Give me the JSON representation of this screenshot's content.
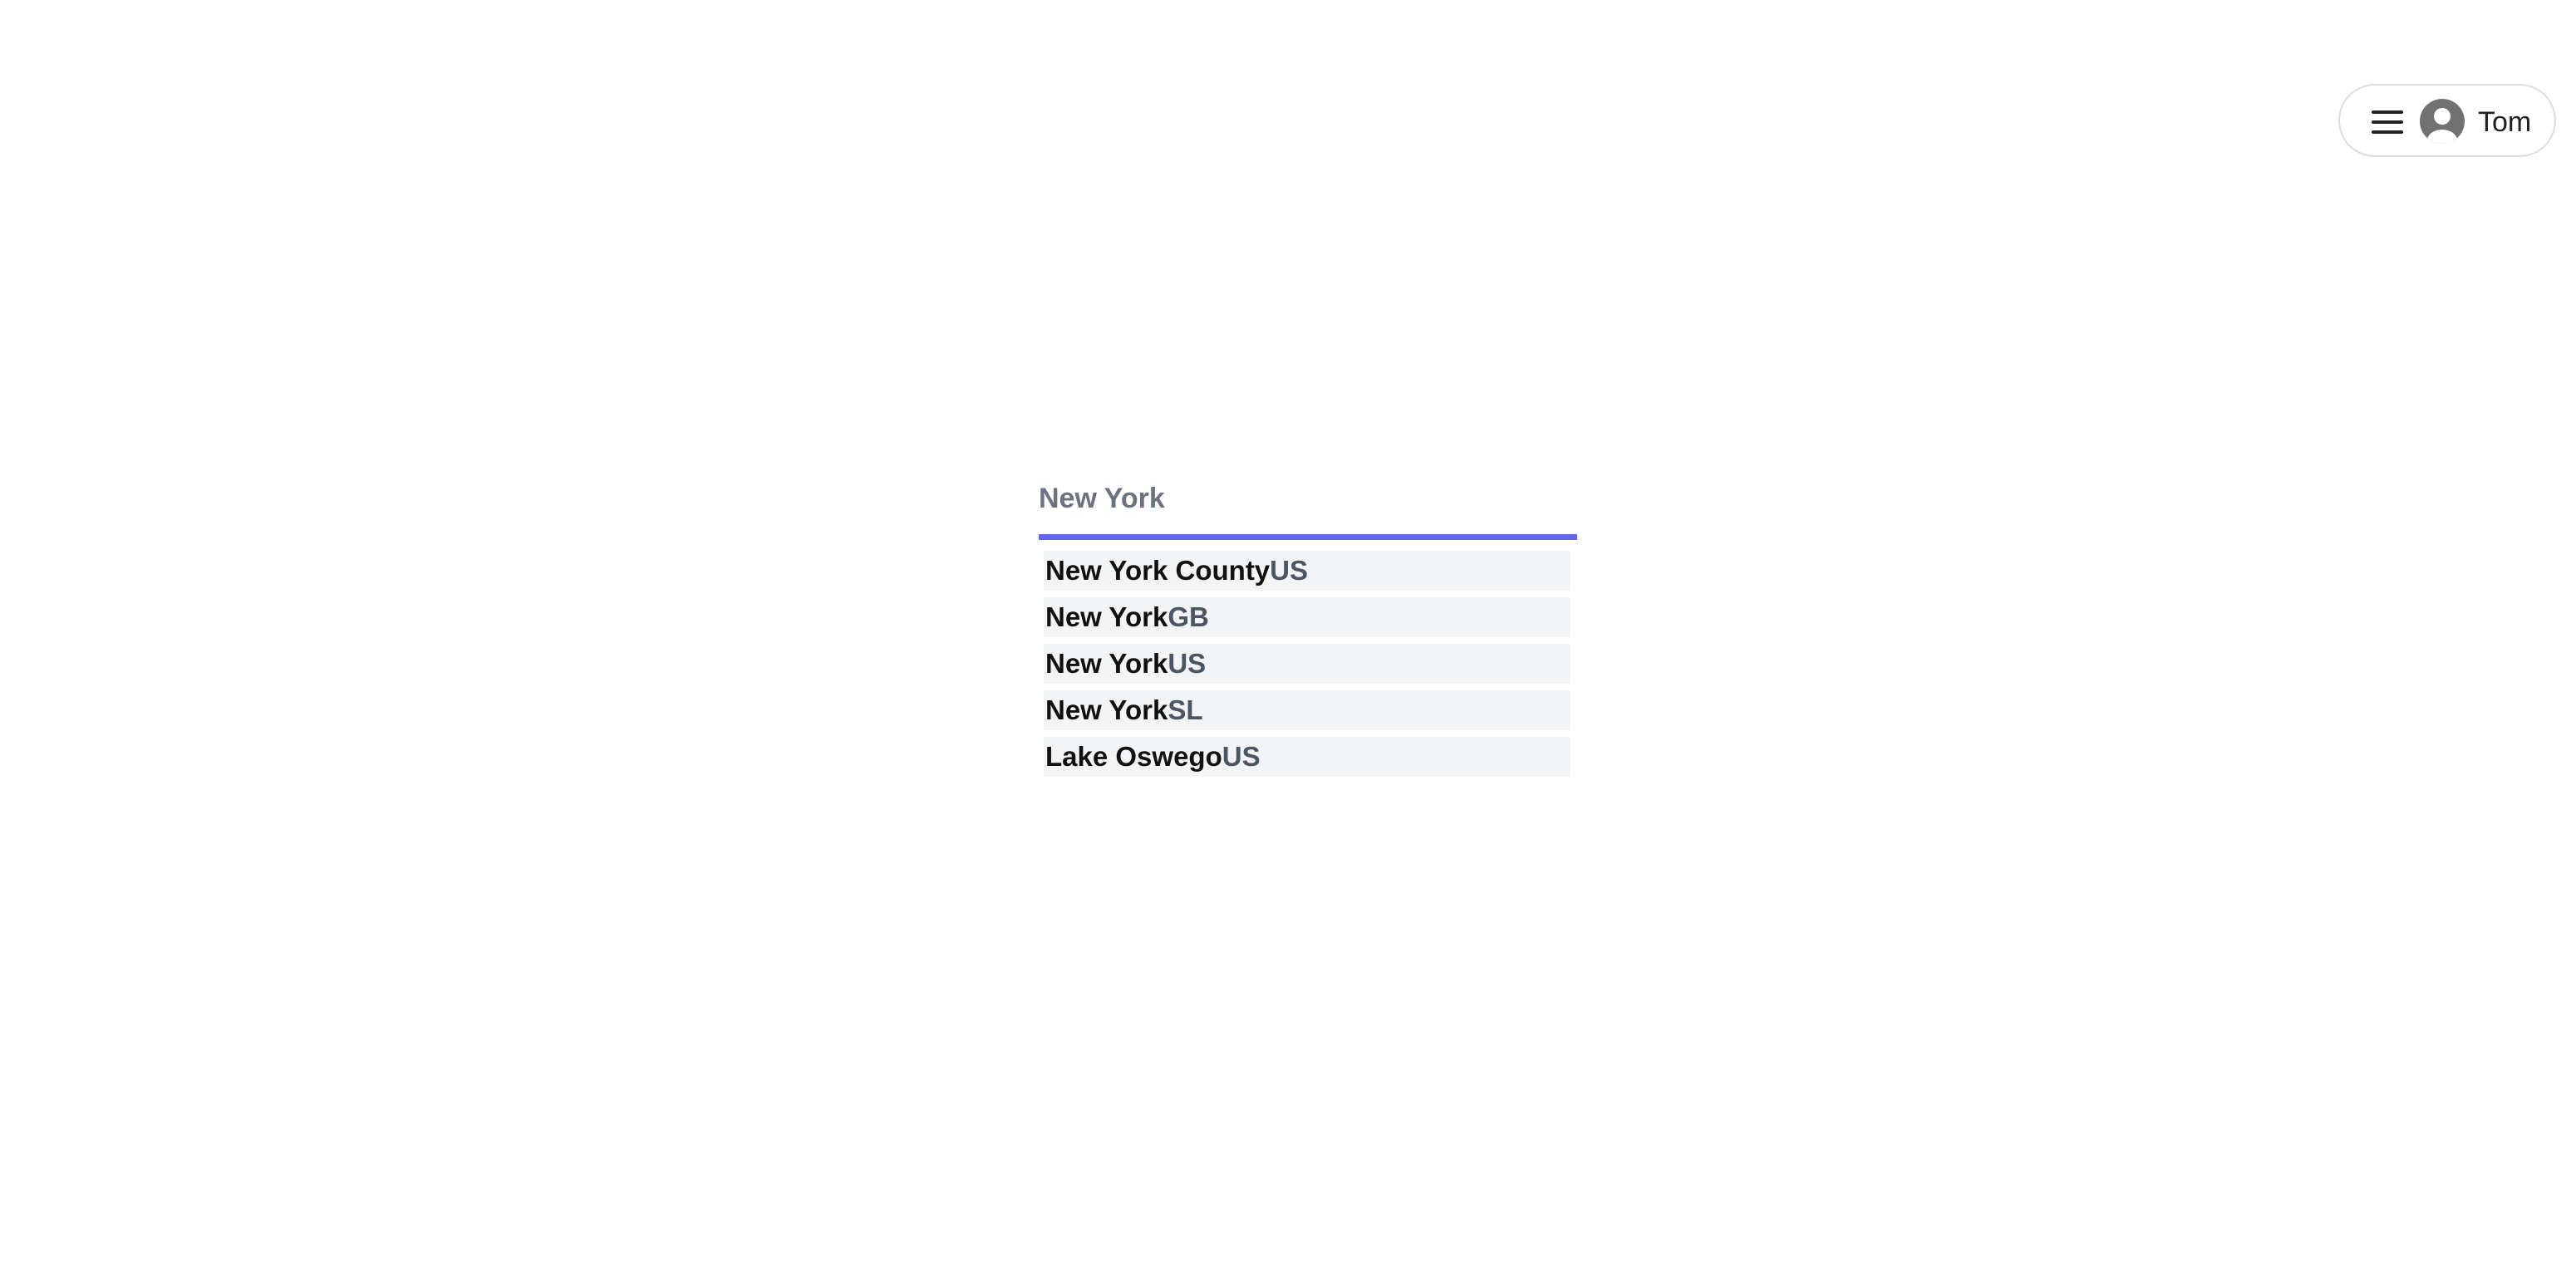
{
  "header": {
    "user_menu": {
      "menu_icon": "hamburger-menu-icon",
      "avatar_icon": "user-avatar-icon",
      "user_name": "Tom"
    }
  },
  "search": {
    "value": "New York",
    "placeholder": ""
  },
  "suggestions": [
    {
      "city": "New York County",
      "country": "US"
    },
    {
      "city": "New York",
      "country": "GB"
    },
    {
      "city": "New York",
      "country": "US"
    },
    {
      "city": "New York",
      "country": "SL"
    },
    {
      "city": "Lake Oswego",
      "country": "US"
    }
  ],
  "colors": {
    "accent": "#6366f1",
    "suggestion_bg": "#f3f4f6",
    "input_text": "#6b7280",
    "country_text": "#4b5563"
  }
}
